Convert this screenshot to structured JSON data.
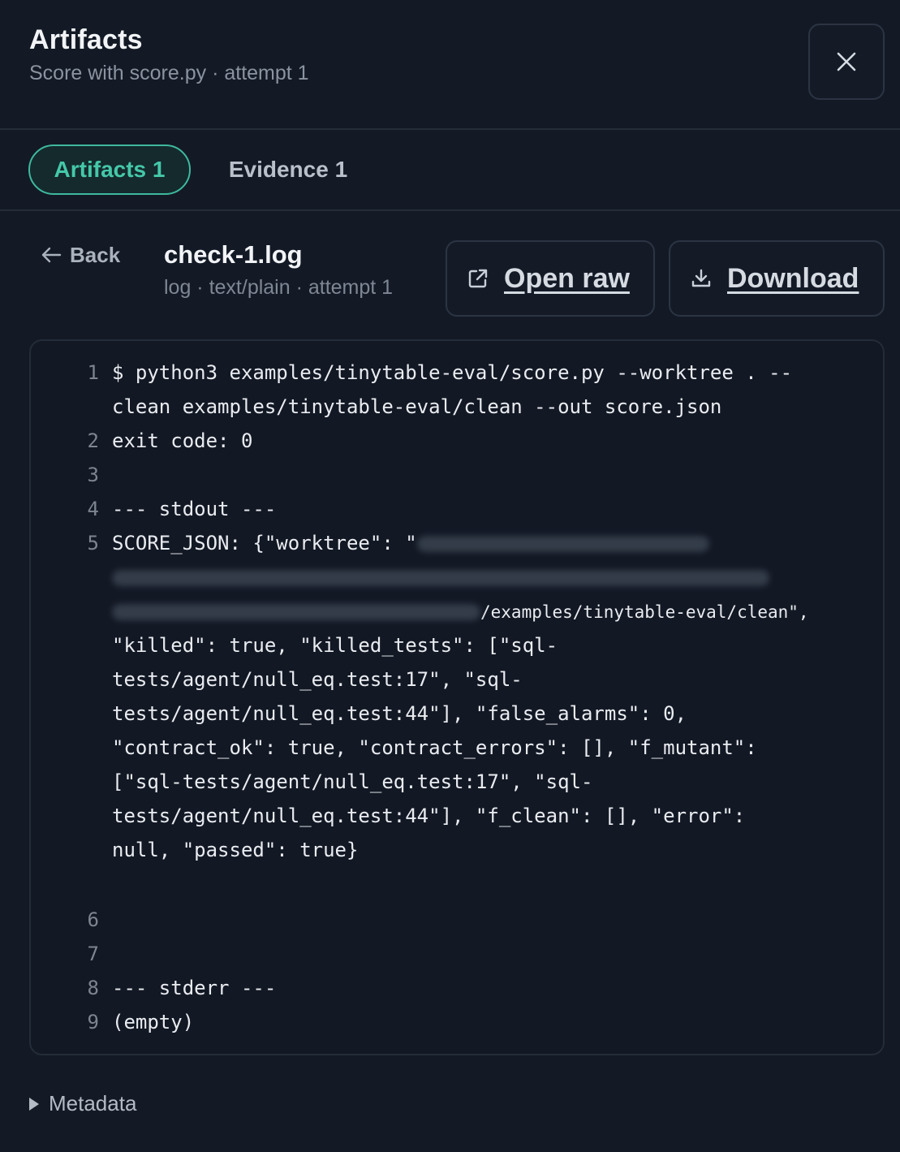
{
  "header": {
    "title": "Artifacts",
    "subtitle": "Score with score.py · attempt 1"
  },
  "tabs": [
    {
      "label": "Artifacts 1",
      "active": true
    },
    {
      "label": "Evidence 1",
      "active": false
    }
  ],
  "file": {
    "back_label": "Back",
    "name": "check-1.log",
    "meta": "log · text/plain · attempt 1",
    "open_raw_label": "Open raw",
    "download_label": "Download"
  },
  "code": {
    "line1": "$ python3 examples/tinytable-eval/score.py --worktree . --",
    "line1b": "clean examples/tinytable-eval/clean --out score.json",
    "line2": "exit code: 0",
    "line3": "",
    "line4": "--- stdout ---",
    "line5a": "SCORE_JSON: {\"worktree\": \"",
    "line5_redacted_tail": "/examples/tinytable-eval/clean\",",
    "line5c": "\"killed\": true, \"killed_tests\": [\"sql-",
    "line5d": "tests/agent/null_eq.test:17\", \"sql-",
    "line5e": "tests/agent/null_eq.test:44\"], \"false_alarms\": 0,",
    "line5f": "\"contract_ok\": true, \"contract_errors\": [], \"f_mutant\":",
    "line5g": "[\"sql-tests/agent/null_eq.test:17\", \"sql-",
    "line5h": "tests/agent/null_eq.test:44\"], \"f_clean\": [], \"error\":",
    "line5i": "null, \"passed\": true}",
    "line6": "",
    "line7": "",
    "line8": "--- stderr ---",
    "line9": "(empty)",
    "numbers": [
      "1",
      "2",
      "3",
      "4",
      "5",
      "6",
      "7",
      "8",
      "9"
    ]
  },
  "metadata_label": "Metadata",
  "colors": {
    "background": "#131a26",
    "accent": "#45c8a8",
    "border": "#242c39"
  }
}
